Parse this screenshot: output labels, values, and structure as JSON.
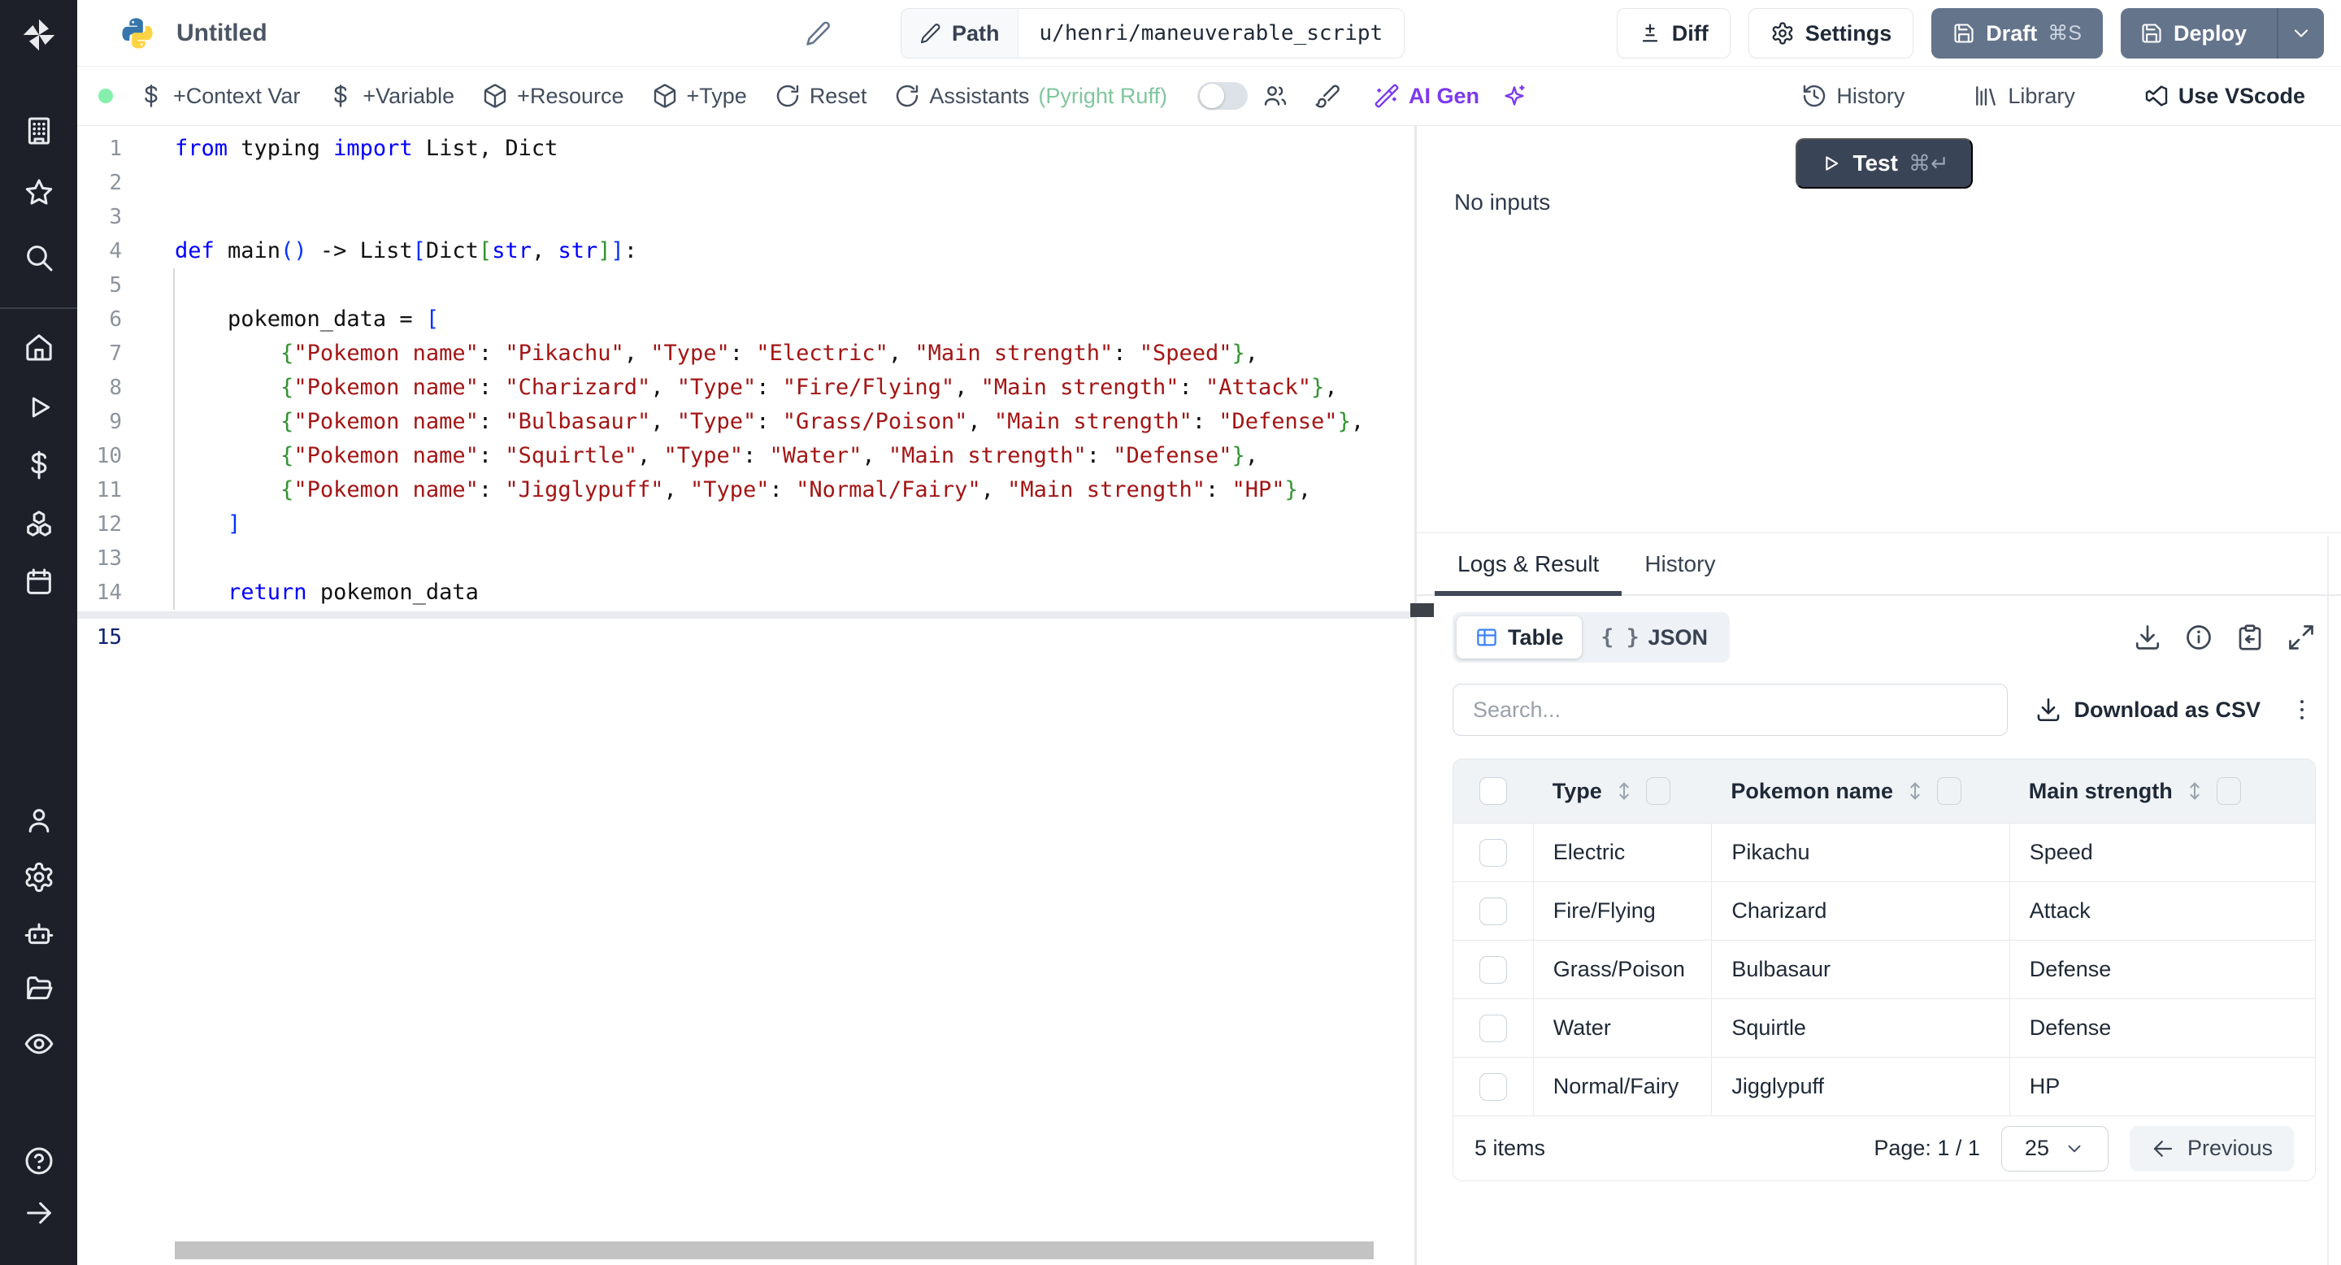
{
  "sidebar": {
    "icons": [
      "windmill-logo",
      "building",
      "star",
      "search",
      "home",
      "play",
      "dollar",
      "cubes",
      "calendar",
      "user",
      "settings",
      "robot",
      "folder",
      "eye",
      "help",
      "arrow-right"
    ]
  },
  "header": {
    "title": "Untitled",
    "path_label": "Path",
    "path_value": "u/henri/maneuverable_script",
    "diff_label": "Diff",
    "settings_label": "Settings",
    "draft_label": "Draft",
    "draft_shortcut": "⌘S",
    "deploy_label": "Deploy"
  },
  "toolbar": {
    "context_var": "+Context Var",
    "variable": "+Variable",
    "resource": "+Resource",
    "type": "+Type",
    "reset": "Reset",
    "assistants": "Assistants",
    "assistants_detail": "(Pyright Ruff)",
    "ai_gen": "AI Gen",
    "history": "History",
    "library": "Library",
    "vscode": "Use VScode"
  },
  "editor": {
    "language": "python",
    "active_line": 15,
    "lines": [
      {
        "n": 1,
        "tokens": [
          [
            "k",
            "from"
          ],
          [
            "p",
            " typing "
          ],
          [
            "k",
            "import"
          ],
          [
            "p",
            " List, Dict"
          ]
        ]
      },
      {
        "n": 2,
        "tokens": []
      },
      {
        "n": 3,
        "tokens": []
      },
      {
        "n": 4,
        "tokens": [
          [
            "k",
            "def"
          ],
          [
            "p",
            " main"
          ],
          [
            "b1",
            "()"
          ],
          [
            "p",
            " -> List"
          ],
          [
            "b1",
            "["
          ],
          [
            "p",
            "Dict"
          ],
          [
            "b2",
            "["
          ],
          [
            "k",
            "str"
          ],
          [
            "p",
            ", "
          ],
          [
            "k",
            "str"
          ],
          [
            "b2",
            "]"
          ],
          [
            "b1",
            "]"
          ],
          [
            "p",
            ":"
          ]
        ]
      },
      {
        "n": 5,
        "tokens": []
      },
      {
        "n": 6,
        "tokens": [
          [
            "p",
            "    pokemon_data = "
          ],
          [
            "b1",
            "["
          ]
        ]
      },
      {
        "n": 7,
        "tokens": [
          [
            "p",
            "        "
          ],
          [
            "b2",
            "{"
          ],
          [
            "s",
            "\"Pokemon name\""
          ],
          [
            "p",
            ": "
          ],
          [
            "s",
            "\"Pikachu\""
          ],
          [
            "p",
            ", "
          ],
          [
            "s",
            "\"Type\""
          ],
          [
            "p",
            ": "
          ],
          [
            "s",
            "\"Electric\""
          ],
          [
            "p",
            ", "
          ],
          [
            "s",
            "\"Main strength\""
          ],
          [
            "p",
            ": "
          ],
          [
            "s",
            "\"Speed\""
          ],
          [
            "b2",
            "}"
          ],
          [
            "p",
            ","
          ]
        ]
      },
      {
        "n": 8,
        "tokens": [
          [
            "p",
            "        "
          ],
          [
            "b2",
            "{"
          ],
          [
            "s",
            "\"Pokemon name\""
          ],
          [
            "p",
            ": "
          ],
          [
            "s",
            "\"Charizard\""
          ],
          [
            "p",
            ", "
          ],
          [
            "s",
            "\"Type\""
          ],
          [
            "p",
            ": "
          ],
          [
            "s",
            "\"Fire/Flying\""
          ],
          [
            "p",
            ", "
          ],
          [
            "s",
            "\"Main strength\""
          ],
          [
            "p",
            ": "
          ],
          [
            "s",
            "\"Attack\""
          ],
          [
            "b2",
            "}"
          ],
          [
            "p",
            ","
          ]
        ]
      },
      {
        "n": 9,
        "tokens": [
          [
            "p",
            "        "
          ],
          [
            "b2",
            "{"
          ],
          [
            "s",
            "\"Pokemon name\""
          ],
          [
            "p",
            ": "
          ],
          [
            "s",
            "\"Bulbasaur\""
          ],
          [
            "p",
            ", "
          ],
          [
            "s",
            "\"Type\""
          ],
          [
            "p",
            ": "
          ],
          [
            "s",
            "\"Grass/Poison\""
          ],
          [
            "p",
            ", "
          ],
          [
            "s",
            "\"Main strength\""
          ],
          [
            "p",
            ": "
          ],
          [
            "s",
            "\"Defense\""
          ],
          [
            "b2",
            "}"
          ],
          [
            "p",
            ","
          ]
        ]
      },
      {
        "n": 10,
        "tokens": [
          [
            "p",
            "        "
          ],
          [
            "b2",
            "{"
          ],
          [
            "s",
            "\"Pokemon name\""
          ],
          [
            "p",
            ": "
          ],
          [
            "s",
            "\"Squirtle\""
          ],
          [
            "p",
            ", "
          ],
          [
            "s",
            "\"Type\""
          ],
          [
            "p",
            ": "
          ],
          [
            "s",
            "\"Water\""
          ],
          [
            "p",
            ", "
          ],
          [
            "s",
            "\"Main strength\""
          ],
          [
            "p",
            ": "
          ],
          [
            "s",
            "\"Defense\""
          ],
          [
            "b2",
            "}"
          ],
          [
            "p",
            ","
          ]
        ]
      },
      {
        "n": 11,
        "tokens": [
          [
            "p",
            "        "
          ],
          [
            "b2",
            "{"
          ],
          [
            "s",
            "\"Pokemon name\""
          ],
          [
            "p",
            ": "
          ],
          [
            "s",
            "\"Jigglypuff\""
          ],
          [
            "p",
            ", "
          ],
          [
            "s",
            "\"Type\""
          ],
          [
            "p",
            ": "
          ],
          [
            "s",
            "\"Normal/Fairy\""
          ],
          [
            "p",
            ", "
          ],
          [
            "s",
            "\"Main strength\""
          ],
          [
            "p",
            ": "
          ],
          [
            "s",
            "\"HP\""
          ],
          [
            "b2",
            "}"
          ],
          [
            "p",
            ","
          ]
        ]
      },
      {
        "n": 12,
        "tokens": [
          [
            "p",
            "    "
          ],
          [
            "b1",
            "]"
          ]
        ]
      },
      {
        "n": 13,
        "tokens": []
      },
      {
        "n": 14,
        "tokens": [
          [
            "p",
            "    "
          ],
          [
            "k",
            "return"
          ],
          [
            "p",
            " pokemon_data"
          ]
        ]
      },
      {
        "n": 15,
        "tokens": []
      }
    ]
  },
  "runner": {
    "test_label": "Test",
    "test_shortcut": "⌘↵",
    "no_inputs": "No inputs"
  },
  "result": {
    "tabs": [
      {
        "label": "Logs & Result",
        "active": true
      },
      {
        "label": "History",
        "active": false
      }
    ],
    "views": [
      {
        "label": "Table",
        "icon": "table-icon",
        "active": true
      },
      {
        "label": "JSON",
        "icon": "braces-icon",
        "active": false
      }
    ],
    "action_icons": [
      "download-icon",
      "info-icon",
      "clipboard-copy-icon",
      "expand-icon"
    ],
    "search_placeholder": "Search...",
    "download_csv": "Download as CSV",
    "table": {
      "columns": [
        "Type",
        "Pokemon name",
        "Main strength"
      ],
      "rows": [
        [
          "Electric",
          "Pikachu",
          "Speed"
        ],
        [
          "Fire/Flying",
          "Charizard",
          "Attack"
        ],
        [
          "Grass/Poison",
          "Bulbasaur",
          "Defense"
        ],
        [
          "Water",
          "Squirtle",
          "Defense"
        ],
        [
          "Normal/Fairy",
          "Jigglypuff",
          "HP"
        ]
      ]
    },
    "footer": {
      "items": "5 items",
      "page": "Page: 1 / 1",
      "page_size": "25",
      "previous": "Previous"
    }
  },
  "colors": {
    "sidebar_bg": "#1d2028",
    "slate_button": "#64748b",
    "test_button": "#3a4457",
    "ai_purple": "#7c3aed",
    "assistant_green": "#7fc69d",
    "status_dot_green": "#86efac",
    "table_icon_blue": "#3b82f6",
    "code_keyword": "#0000ff",
    "code_string": "#a31515",
    "bracket_blue": "#0431fa",
    "bracket_green": "#319331"
  }
}
